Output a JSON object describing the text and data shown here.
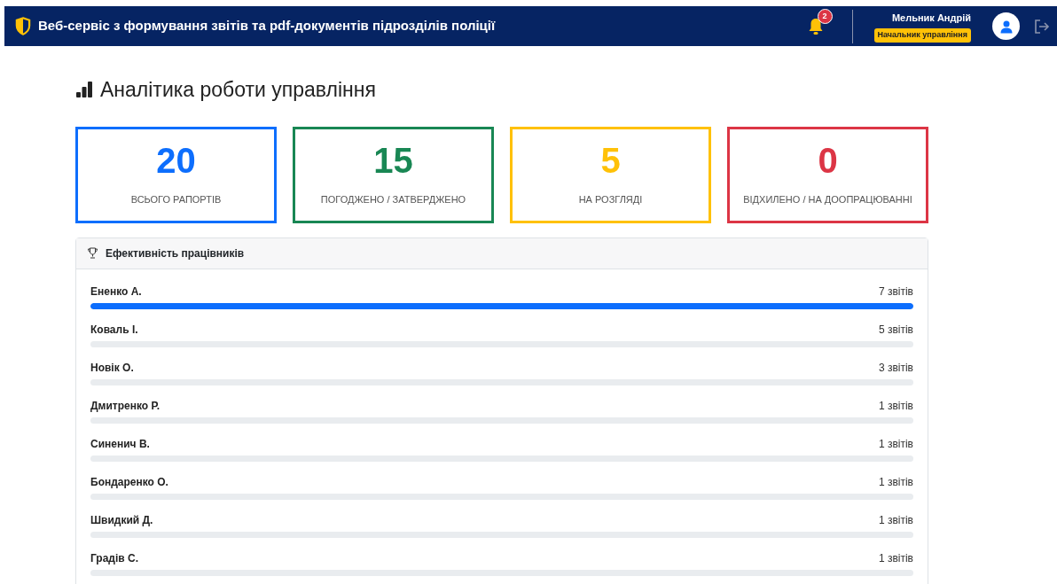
{
  "header": {
    "title": "Веб-сервіс з формування звітів та pdf-документів підрозділів поліції",
    "notifications": "2",
    "user": {
      "name": "Мельник Андрій",
      "role": "Начальник управління"
    }
  },
  "page_title": "Аналітика роботи управління",
  "stats": [
    {
      "value": "20",
      "label": "ВСЬОГО РАПОРТІВ",
      "color": "#0d6efd"
    },
    {
      "value": "15",
      "label": "ПОГОДЖЕНО / ЗАТВЕРДЖЕНО",
      "color": "#198754"
    },
    {
      "value": "5",
      "label": "НА РОЗГЛЯДІ",
      "color": "#ffc107"
    },
    {
      "value": "0",
      "label": "ВІДХИЛЕНО / НА ДООПРАЦЮВАННІ",
      "color": "#dc3545"
    }
  ],
  "performance": {
    "title": "Ефективність працівників",
    "employees": [
      {
        "name": "Ененко А.",
        "count": "7 звітів",
        "level": 1
      },
      {
        "name": "Коваль І.",
        "count": "5 звітів",
        "level": 0
      },
      {
        "name": "Новік О.",
        "count": "3 звітів",
        "level": 0
      },
      {
        "name": "Дмитренко Р.",
        "count": "1 звітів",
        "level": 0
      },
      {
        "name": "Синенич В.",
        "count": "1 звітів",
        "level": 0
      },
      {
        "name": "Бондаренко О.",
        "count": "1 звітів",
        "level": 0
      },
      {
        "name": "Швидкий Д.",
        "count": "1 звітів",
        "level": 0
      },
      {
        "name": "Градів С.",
        "count": "1 звітів",
        "level": 0
      }
    ]
  }
}
